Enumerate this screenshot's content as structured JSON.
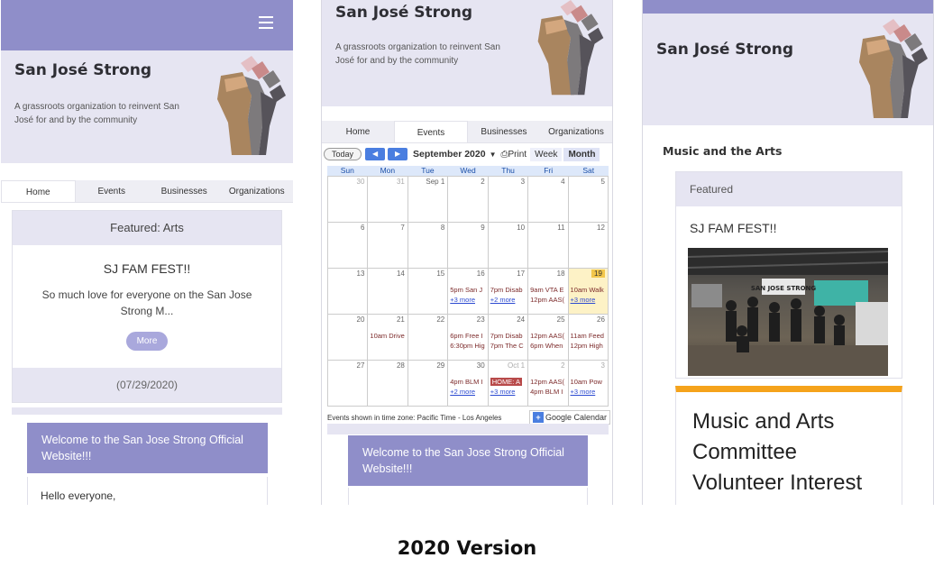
{
  "site": {
    "title": "San José Strong",
    "tagline": "A grassroots organization to reinvent San José for and by the community"
  },
  "nav_tabs": [
    "Home",
    "Events",
    "Businesses",
    "Organizations"
  ],
  "screen_home": {
    "featured_header": "Featured: Arts",
    "featured_title": "SJ FAM FEST!!",
    "featured_excerpt": "So much love for everyone on the San Jose Strong M...",
    "more_button": "More",
    "featured_date": "(07/29/2020)",
    "welcome": "Welcome to the San Jose Strong Official Website!!!",
    "welcome_body": "Hello everyone,"
  },
  "screen_events": {
    "today_button": "Today",
    "month": "September 2020",
    "print": "Print",
    "views": [
      "Week",
      "Month"
    ],
    "weekdays": [
      "Sun",
      "Mon",
      "Tue",
      "Wed",
      "Thu",
      "Fri",
      "Sat"
    ],
    "weeks": [
      [
        {
          "d": "30",
          "o": true
        },
        {
          "d": "31",
          "o": true
        },
        {
          "d": "Sep 1"
        },
        {
          "d": "2"
        },
        {
          "d": "3"
        },
        {
          "d": "4"
        },
        {
          "d": "5"
        }
      ],
      [
        {
          "d": "6"
        },
        {
          "d": "7"
        },
        {
          "d": "8"
        },
        {
          "d": "9"
        },
        {
          "d": "10"
        },
        {
          "d": "11"
        },
        {
          "d": "12"
        }
      ],
      [
        {
          "d": "13"
        },
        {
          "d": "14"
        },
        {
          "d": "15"
        },
        {
          "d": "16",
          "ev": [
            "5pm San J",
            "+3 more"
          ]
        },
        {
          "d": "17",
          "ev": [
            "7pm Disab",
            "+2 more"
          ]
        },
        {
          "d": "18",
          "ev": [
            "9am VTA E",
            "12pm AAS("
          ]
        },
        {
          "d": "19",
          "t": true,
          "ev": [
            "10am Walk",
            "+3 more"
          ]
        }
      ],
      [
        {
          "d": "20"
        },
        {
          "d": "21",
          "ev": [
            "10am Drive"
          ]
        },
        {
          "d": "22"
        },
        {
          "d": "23",
          "ev": [
            "6pm Free I",
            "6:30pm Hig"
          ]
        },
        {
          "d": "24",
          "ev": [
            "7pm Disab",
            "7pm The C"
          ]
        },
        {
          "d": "25",
          "ev": [
            "12pm AAS(",
            "6pm When"
          ]
        },
        {
          "d": "26",
          "ev": [
            "11am Feed",
            "12pm High"
          ]
        }
      ],
      [
        {
          "d": "27"
        },
        {
          "d": "28"
        },
        {
          "d": "29"
        },
        {
          "d": "30",
          "ev": [
            "4pm BLM I",
            "+2 more"
          ]
        },
        {
          "d": "Oct 1",
          "o": true,
          "ev": [
            "HOME: A",
            "+3 more"
          ],
          "hl": true
        },
        {
          "d": "2",
          "o": true,
          "ev": [
            "12pm AAS(",
            "4pm BLM I"
          ]
        },
        {
          "d": "3",
          "o": true,
          "ev": [
            "10am Pow",
            "+3 more"
          ]
        }
      ]
    ],
    "timezone_note": "Events shown in time zone: Pacific Time - Los Angeles",
    "gcal_label": "Google Calendar",
    "welcome": "Welcome to the San Jose Strong Official Website!!!"
  },
  "screen_arts": {
    "section": "Music and the Arts",
    "featured_header": "Featured",
    "featured_title": "SJ FAM FEST!!",
    "photo_sign": "SAN JOSE STRONG",
    "form_title": "Music and Arts Committee Volunteer Interest Form"
  },
  "caption": "2020 Version",
  "colors": {
    "accent": "#8f8ec9",
    "hero_bg": "#e6e5f2",
    "button": "#a9a8dc",
    "form_accent": "#f5a31b",
    "fist": [
      "#e4bfc4",
      "#c98a8a",
      "#d3a77e",
      "#a9855f",
      "#7d7a7c",
      "#56535a"
    ]
  }
}
